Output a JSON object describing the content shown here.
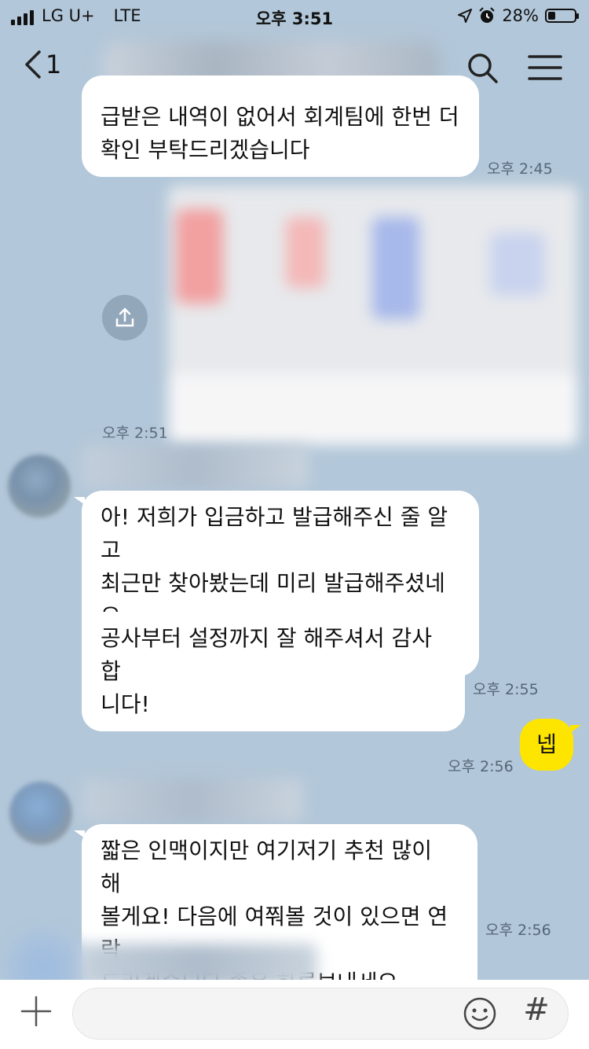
{
  "status_bar": {
    "carrier": "LG U+",
    "network": "LTE",
    "time": "오후 3:51",
    "battery": "28%",
    "battery_level": 0.28
  },
  "header": {
    "unread_count": "1"
  },
  "messages": [
    {
      "text": "급받은 내역이 없어서 회계팀에 한번 더\n확인 부탁드리겠습니다",
      "time": "오후 2:45"
    },
    {
      "time": "오후 2:51"
    },
    {
      "text": "아! 저희가 입금하고 발급해주신 줄 알고\n최근만 찾아봤는데 미리 발급해주셨네요\n확인했습니다"
    },
    {
      "text": "공사부터 설정까지 잘 해주셔서 감사합\n니다!",
      "time": "오후 2:55"
    },
    {
      "text": "넵",
      "time": "오후 2:56"
    },
    {
      "text": "짧은 인맥이지만 여기저기 추천 많이 해\n볼게요! 다음에 여쭤볼 것이 있으면 연락\n드리겠습니다 좋은 하루보내세요~",
      "time": "오후 2:56"
    }
  ],
  "input_bar": {
    "placeholder": "",
    "hash_symbol": "#"
  },
  "colors": {
    "background": "#b2c7d9",
    "my_bubble": "#fee500",
    "other_bubble": "#ffffff"
  }
}
